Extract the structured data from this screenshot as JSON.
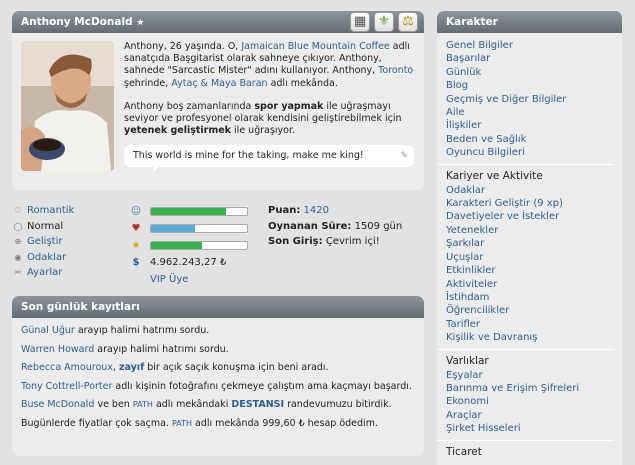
{
  "profile": {
    "name": "Anthony McDonald",
    "star": "★",
    "icons": [
      "calendar-icon",
      "fleur-de-lis-icon",
      "scales-icon"
    ],
    "bio1_a": "Anthony, 26 yaşında. O, ",
    "bio1_link": "Jamaican Blue Mountain Coffee",
    "bio1_b": " adlı sanatçıda Başgitarist olarak sahneye çıkıyor. Anthony, sahnede \"Sarcastic Mister\" adını kullanıyor. Anthony, ",
    "bio1_city": "Toronto",
    "bio1_c": " şehrinde, ",
    "bio1_place": "Aytaç & Maya Baran",
    "bio1_d": " adlı mekânda.",
    "bio2_a": "Anthony boş zamanlarında ",
    "bio2_b1": "spor yapmak",
    "bio2_b": " ile uğraşmayı seviyor ve profesyonel olarak kendisini geliştirebilmek için ",
    "bio2_b2": "yetenek geliştirmek",
    "bio2_c": " ile uğraşıyor.",
    "quote": "This world is mine for the taking, make me king!"
  },
  "moods": [
    {
      "label": "Romantik",
      "icon": "heart-icon"
    },
    {
      "label": "Normal",
      "icon": "circle-icon"
    },
    {
      "label": "Geliştir",
      "icon": "plus-icon"
    },
    {
      "label": "Odaklar",
      "icon": "eye-icon"
    },
    {
      "label": "Ayarlar",
      "icon": "wrench-icon"
    }
  ],
  "stats": {
    "bars": [
      {
        "icon": "smiley-icon",
        "value": 0.78,
        "color": "#38b24a"
      },
      {
        "icon": "heart-icon",
        "value": 0.46,
        "color": "#5aa9d6"
      },
      {
        "icon": "star-icon",
        "value": 0.53,
        "color": "#38b24a"
      }
    ],
    "money": "4.962.243,27 ₺",
    "vip": "VIP Üye",
    "puan_label": "Puan:",
    "puan": "1420",
    "sure_label": "Oynanan Süre:",
    "sure": "1509 gün",
    "giris_label": "Son Giriş:",
    "giris": "Çevrim içi!"
  },
  "log": {
    "title": "Son günlük kayıtları",
    "e1_n": "Günal Uğur",
    "e1_t": " arayıp halimi hatrımı sordu.",
    "e2_n": "Warren Howard",
    "e2_t": " arayıp halimi hatrımı sordu.",
    "e3_n": "Rebecca Amouroux",
    "e3_t1": ", ",
    "e3_b": "zayıf",
    "e3_t2": " bir açık saçık konuşma için beni aradı.",
    "e4_n": "Tony Cottrell-Porter",
    "e4_t": " adlı kişinin fotoğrafını çekmeye çalıştım ama kaçmayı başardı.",
    "e5_n": "Buse McDonald",
    "e5_t1": " ve ben ",
    "e5_l": "PATH",
    "e5_t2": " adlı mekândaki ",
    "e5_b": "DESTANSI",
    "e5_t3": " randevumuzu bitirdik.",
    "e6_t1": "Bugünlerde fiyatlar çok saçma. ",
    "e6_l": "PATH",
    "e6_t2": " adlı mekânda 999,60 ₺ hesap ödedim."
  },
  "sidebar": {
    "title": "Karakter",
    "links1": [
      "Genel Bilgiler",
      "Başarılar",
      "Günlük",
      "Blog",
      "Geçmiş ve Diğer Bilgiler",
      "Aile",
      "İlişkiler",
      "Beden ve Sağlık",
      "Oyuncu Bilgileri"
    ],
    "sec2": "Kariyer ve Aktivite",
    "links2": [
      "Odaklar",
      "Karakteri Geliştir (9 xp)",
      "Davetiyeler ve İstekler",
      "Yetenekler",
      "Şarkılar",
      "Uçuşlar",
      "Etkinlikler",
      "Aktiviteler",
      "İstihdam",
      "Öğrencilikler",
      "Tarifler",
      "Kişilik ve Davranış"
    ],
    "sec3": "Varlıklar",
    "links3": [
      "Eşyalar",
      "Barınma ve Erişim Şifreleri",
      "Ekonomi",
      "Araçlar",
      "Şirket Hisseleri"
    ],
    "sec4": "Ticaret"
  }
}
